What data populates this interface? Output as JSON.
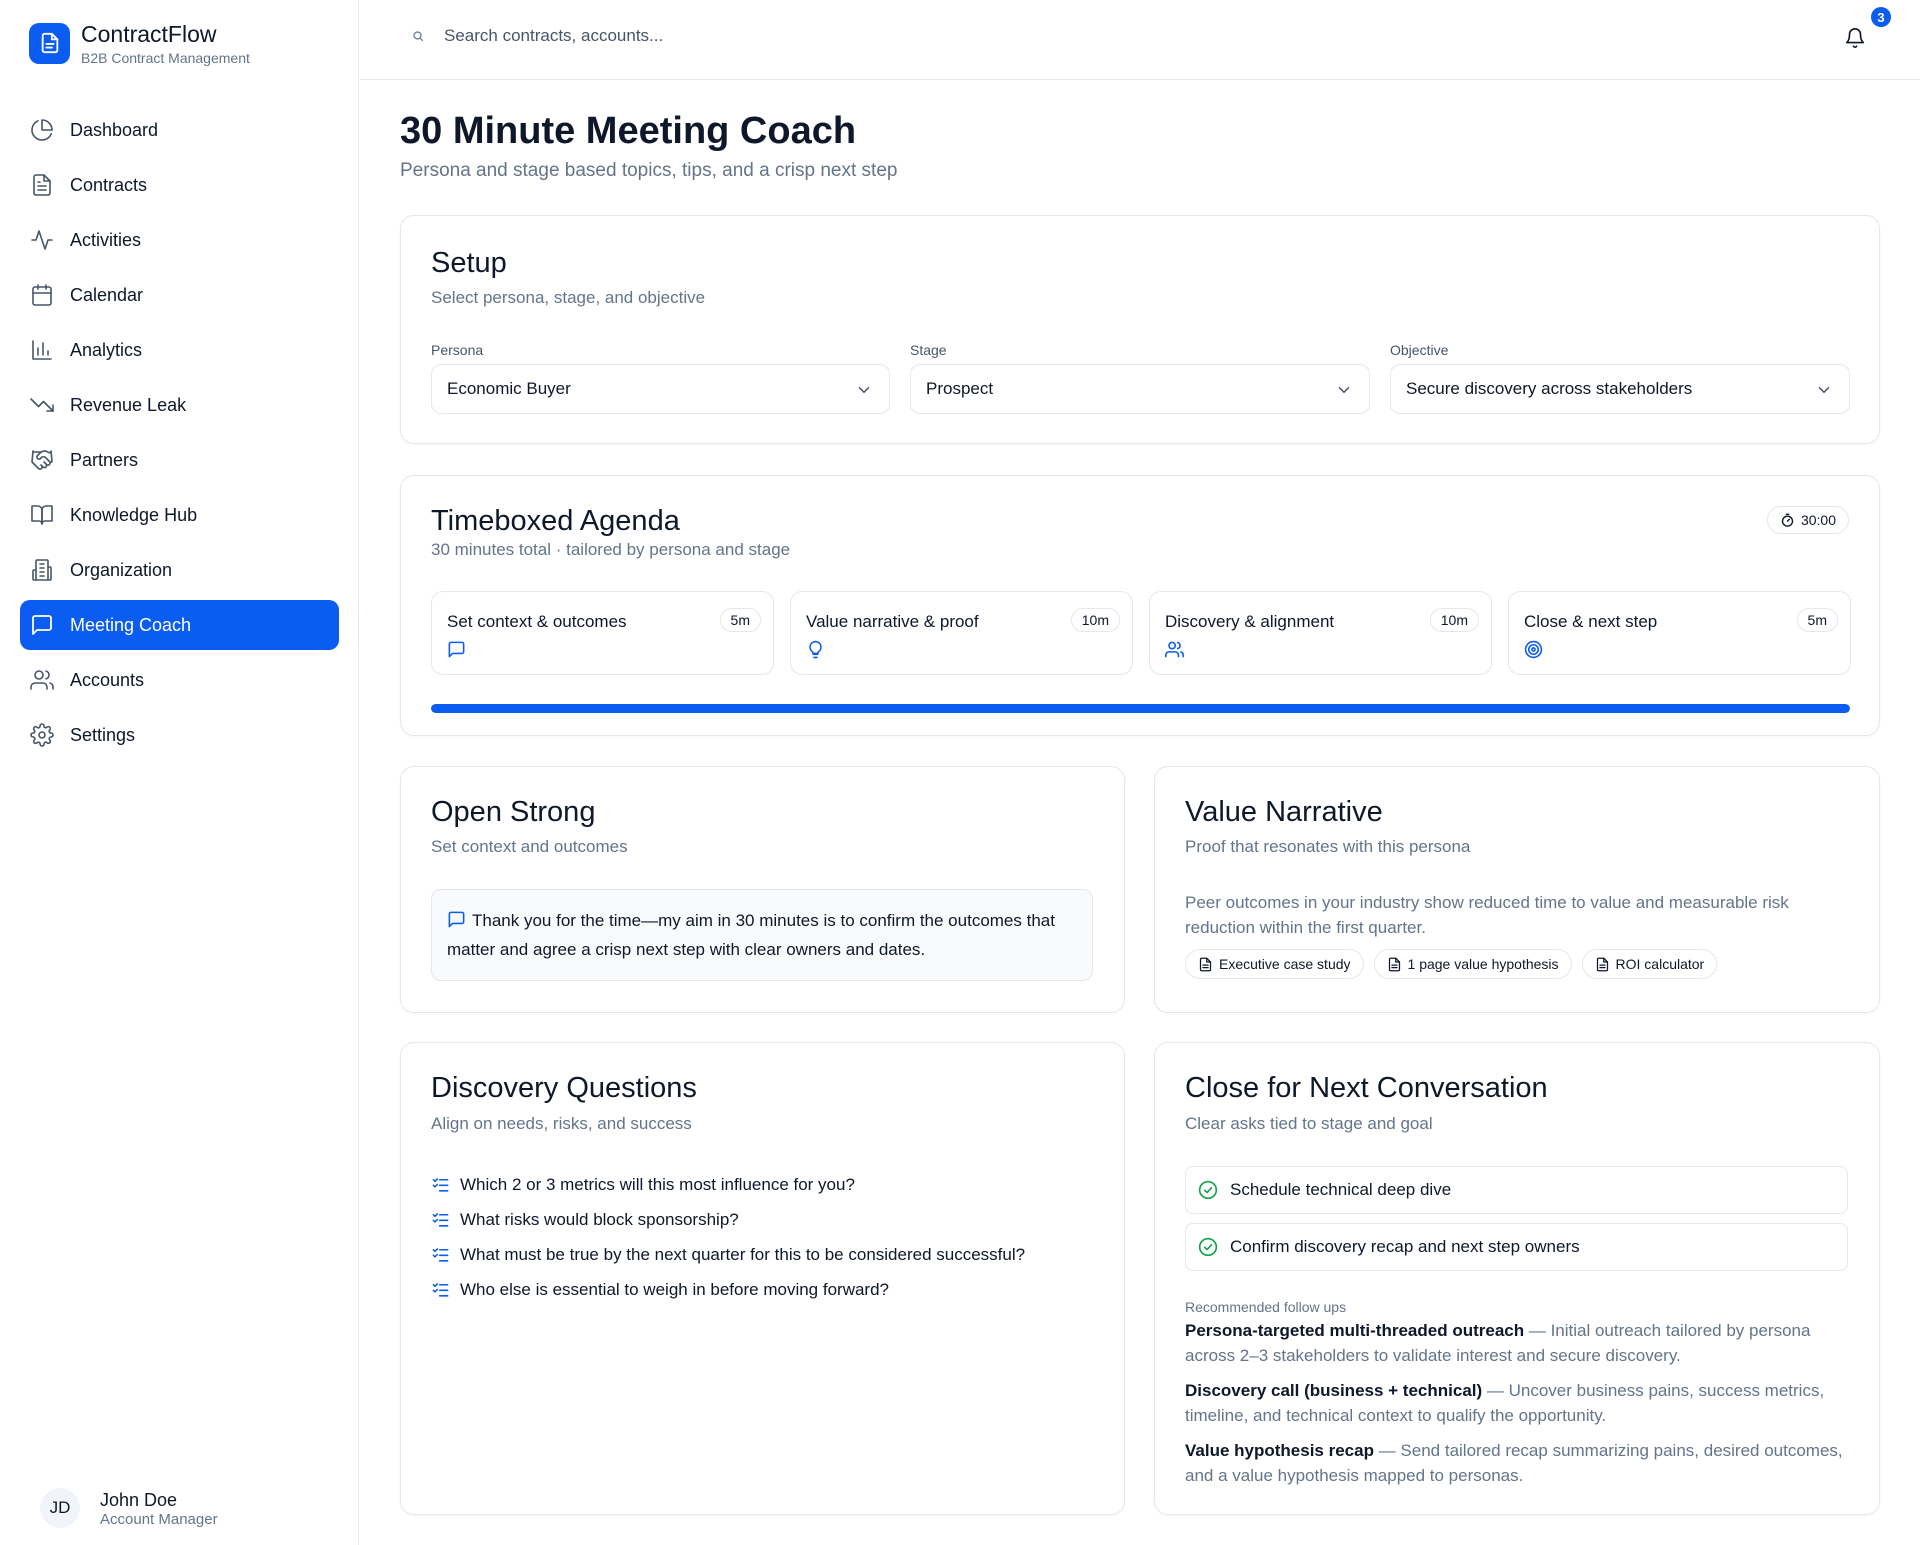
{
  "app": {
    "name": "ContractFlow",
    "subtitle": "B2B Contract Management"
  },
  "sidebar": {
    "items": [
      {
        "label": "Dashboard",
        "icon": "pie-chart-icon"
      },
      {
        "label": "Contracts",
        "icon": "document-icon"
      },
      {
        "label": "Activities",
        "icon": "activity-icon"
      },
      {
        "label": "Calendar",
        "icon": "calendar-icon"
      },
      {
        "label": "Analytics",
        "icon": "bar-chart-icon"
      },
      {
        "label": "Revenue Leak",
        "icon": "trending-down-icon"
      },
      {
        "label": "Partners",
        "icon": "handshake-icon"
      },
      {
        "label": "Knowledge Hub",
        "icon": "book-icon"
      },
      {
        "label": "Organization",
        "icon": "building-icon"
      },
      {
        "label": "Meeting Coach",
        "icon": "message-square-icon",
        "active": true
      },
      {
        "label": "Accounts",
        "icon": "users-icon"
      },
      {
        "label": "Settings",
        "icon": "gear-icon"
      }
    ],
    "user": {
      "initials": "JD",
      "name": "John Doe",
      "role": "Account Manager"
    }
  },
  "topbar": {
    "search_placeholder": "Search contracts, accounts...",
    "notification_count": "3"
  },
  "page": {
    "title": "30 Minute Meeting Coach",
    "subtitle": "Persona and stage based topics, tips, and a crisp next step"
  },
  "setup": {
    "title": "Setup",
    "subtitle": "Select persona, stage, and objective",
    "persona": {
      "label": "Persona",
      "value": "Economic Buyer"
    },
    "stage": {
      "label": "Stage",
      "value": "Prospect"
    },
    "objective": {
      "label": "Objective",
      "value": "Secure discovery across stakeholders"
    }
  },
  "agenda": {
    "title": "Timeboxed Agenda",
    "subtitle": "30 minutes total · tailored by persona and stage",
    "timer": "30:00",
    "progress_percent": 100,
    "items": [
      {
        "label": "Set context & outcomes",
        "duration": "5m",
        "icon": "message-square-icon"
      },
      {
        "label": "Value narrative & proof",
        "duration": "10m",
        "icon": "lightbulb-icon"
      },
      {
        "label": "Discovery & alignment",
        "duration": "10m",
        "icon": "users-icon"
      },
      {
        "label": "Close & next step",
        "duration": "5m",
        "icon": "target-icon"
      }
    ]
  },
  "open_strong": {
    "title": "Open Strong",
    "subtitle": "Set context and outcomes",
    "script": "Thank you for the time—my aim in 30 minutes is to confirm the outcomes that matter and agree a crisp next step with clear owners and dates."
  },
  "value_narrative": {
    "title": "Value Narrative",
    "subtitle": "Proof that resonates with this persona",
    "body": "Peer outcomes in your industry show reduced time to value and measurable risk reduction within the first quarter.",
    "assets": [
      "Executive case study",
      "1 page value hypothesis",
      "ROI calculator"
    ]
  },
  "discovery": {
    "title": "Discovery Questions",
    "subtitle": "Align on needs, risks, and success",
    "questions": [
      "Which 2 or 3 metrics will this most influence for you?",
      "What risks would block sponsorship?",
      "What must be true by the next quarter for this to be considered successful?",
      "Who else is essential to weigh in before moving forward?"
    ]
  },
  "close": {
    "title": "Close for Next Conversation",
    "subtitle": "Clear asks tied to stage and goal",
    "asks": [
      "Schedule technical deep dive",
      "Confirm discovery recap and next step owners"
    ],
    "followups_label": "Recommended follow ups",
    "followups": [
      {
        "title": "Persona-targeted multi-threaded outreach",
        "desc": " — Initial outreach tailored by persona across 2–3 stakeholders to validate interest and secure discovery."
      },
      {
        "title": "Discovery call (business + technical)",
        "desc": " — Uncover business pains, success metrics, timeline, and technical context to qualify the opportunity."
      },
      {
        "title": "Value hypothesis recap",
        "desc": " — Send tailored recap summarizing pains, desired outcomes, and a value hypothesis mapped to personas."
      }
    ]
  },
  "colors": {
    "accent": "#0b5cf0",
    "success": "#16a34a",
    "muted_text": "#64748b",
    "border": "#e5e7eb"
  }
}
